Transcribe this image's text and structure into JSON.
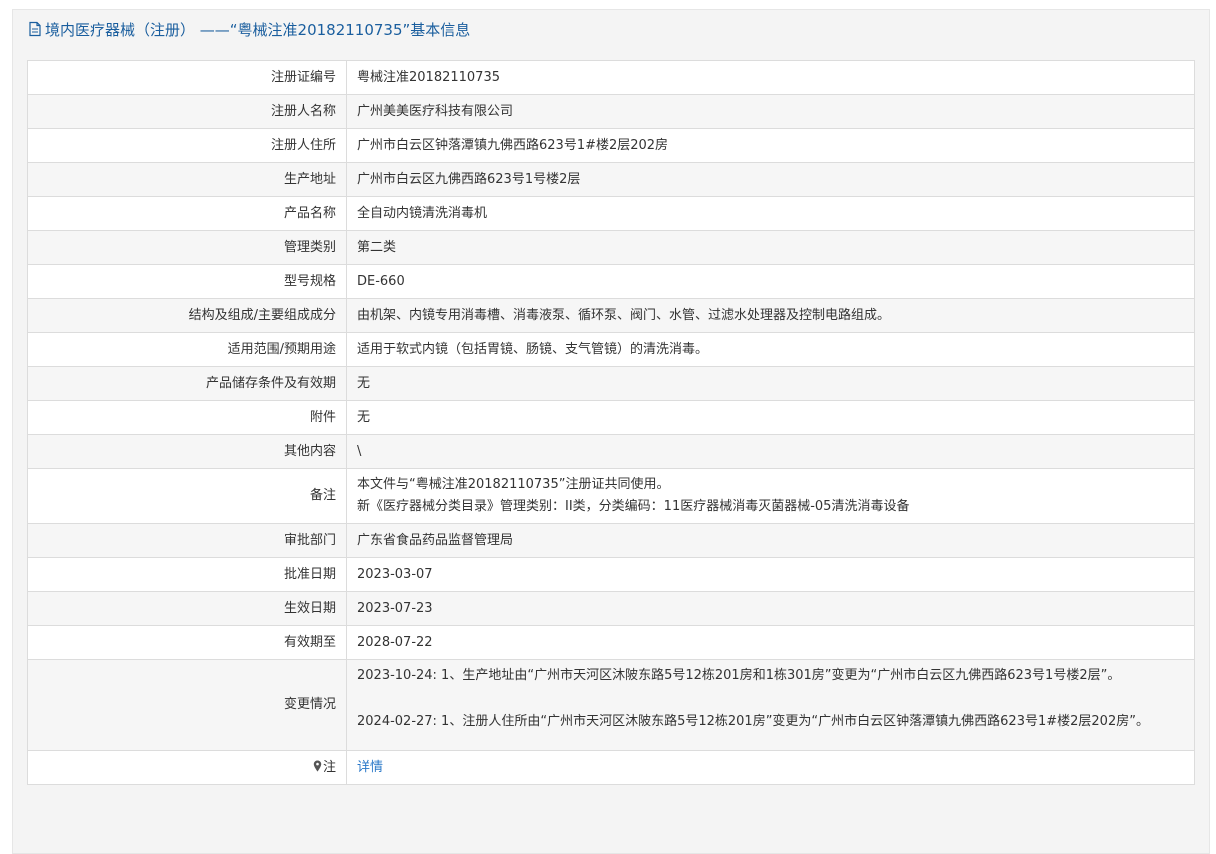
{
  "header": {
    "title": "境内医疗器械（注册） ——“粤械注准20182110735”基本信息",
    "icon": "document-icon"
  },
  "rows": [
    {
      "label": "注册证编号",
      "value": "粤械注准20182110735"
    },
    {
      "label": "注册人名称",
      "value": "广州美美医疗科技有限公司"
    },
    {
      "label": "注册人住所",
      "value": "广州市白云区钟落潭镇九佛西路623号1#楼2层202房"
    },
    {
      "label": "生产地址",
      "value": "广州市白云区九佛西路623号1号楼2层"
    },
    {
      "label": "产品名称",
      "value": "全自动内镜清洗消毒机"
    },
    {
      "label": "管理类别",
      "value": "第二类"
    },
    {
      "label": "型号规格",
      "value": "DE-660"
    },
    {
      "label": "结构及组成/主要组成成分",
      "value": "由机架、内镜专用消毒槽、消毒液泵、循环泵、阀门、水管、过滤水处理器及控制电路组成。"
    },
    {
      "label": "适用范围/预期用途",
      "value": "适用于软式内镜（包括胃镜、肠镜、支气管镜）的清洗消毒。"
    },
    {
      "label": "产品储存条件及有效期",
      "value": "无"
    },
    {
      "label": "附件",
      "value": "无"
    },
    {
      "label": "其他内容",
      "value": "\\"
    }
  ],
  "remark": {
    "label": "备注",
    "lines": [
      "本文件与“粤械注准20182110735”注册证共同使用。",
      "新《医疗器械分类目录》管理类别：II类，分类编码：11医疗器械消毒灭菌器械-05清洗消毒设备"
    ]
  },
  "rows2": [
    {
      "label": "审批部门",
      "value": "广东省食品药品监督管理局"
    },
    {
      "label": "批准日期",
      "value": "2023-03-07"
    },
    {
      "label": "生效日期",
      "value": "2023-07-23"
    },
    {
      "label": "有效期至",
      "value": "2028-07-22"
    }
  ],
  "changes": {
    "label": "变更情况",
    "entries": [
      "2023-10-24: 1、生产地址由“广州市天河区沐陂东路5号12栋201房和1栋301房”变更为“广州市白云区九佛西路623号1号楼2层”。",
      "2024-02-27: 1、注册人住所由“广州市天河区沐陂东路5号12栋201房”变更为“广州市白云区钟落潭镇九佛西路623号1#楼2层202房”。"
    ]
  },
  "note": {
    "label": "注",
    "icon": "map-pin-icon",
    "link_text": "详情"
  },
  "colors": {
    "header_text": "#1a5e9e",
    "link": "#2a78c8",
    "border": "#dcdcdc",
    "stripe": "#f6f6f6"
  }
}
